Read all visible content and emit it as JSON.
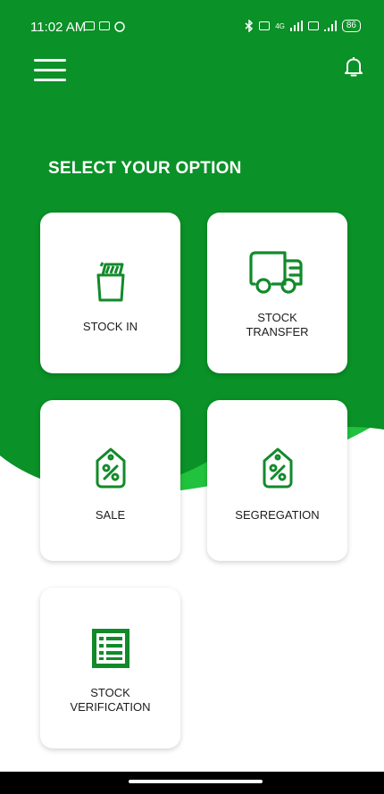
{
  "colors": {
    "brand_green": "#0a9127",
    "accent_green": "#21c23e",
    "icon_green": "#128a2a"
  },
  "status_bar": {
    "time": "11:02 AM",
    "network": "4G",
    "battery": "86"
  },
  "app_bar": {
    "menu_icon": "hamburger-menu-icon",
    "notification_icon": "bell-icon"
  },
  "heading": "SELECT YOUR OPTION",
  "options": [
    {
      "label": "STOCK IN",
      "icon": "box-in-icon"
    },
    {
      "label": "STOCK\nTRANSFER",
      "icon": "truck-icon"
    },
    {
      "label": "SALE",
      "icon": "percent-tag-icon"
    },
    {
      "label": "SEGREGATION",
      "icon": "percent-tag-icon"
    },
    {
      "label": "STOCK\nVERIFICATION",
      "icon": "list-sheet-icon"
    }
  ]
}
